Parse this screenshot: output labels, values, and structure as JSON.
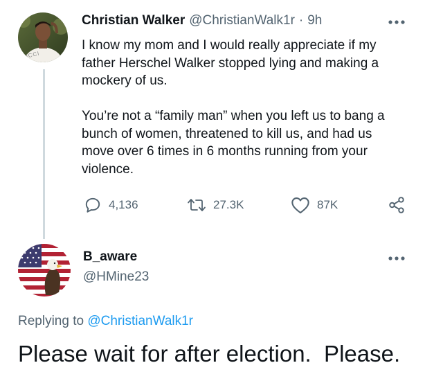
{
  "tweet": {
    "author_name": "Christian Walker",
    "author_handle": "@ChristianWalk1r",
    "separator": "·",
    "time": "9h",
    "avatar_text": "UCCI",
    "body": "I know my mom and I would really appreciate if my father Herschel Walker stopped lying and making a mockery of us.\n\nYou’re not a “family man” when you left us to bang a bunch of women, threatened to kill us, and had us move over 6 times in 6 months running from your violence.",
    "replies": "4,136",
    "retweets": "27.3K",
    "likes": "87K"
  },
  "reply": {
    "author_name": "B_aware",
    "author_handle": "@HMine23",
    "replying_prefix": "Replying to",
    "replying_handle": "@ChristianWalk1r",
    "body": "Please wait for after election.  Please."
  },
  "icons": {
    "more": "more-dots-icon",
    "reply": "reply-bubble-icon",
    "retweet": "retweet-icon",
    "like": "heart-icon",
    "share": "share-icon"
  },
  "colors": {
    "text": "#0f1419",
    "muted": "#536471",
    "link": "#1d9bf0",
    "thread_line": "#cfd9de"
  }
}
